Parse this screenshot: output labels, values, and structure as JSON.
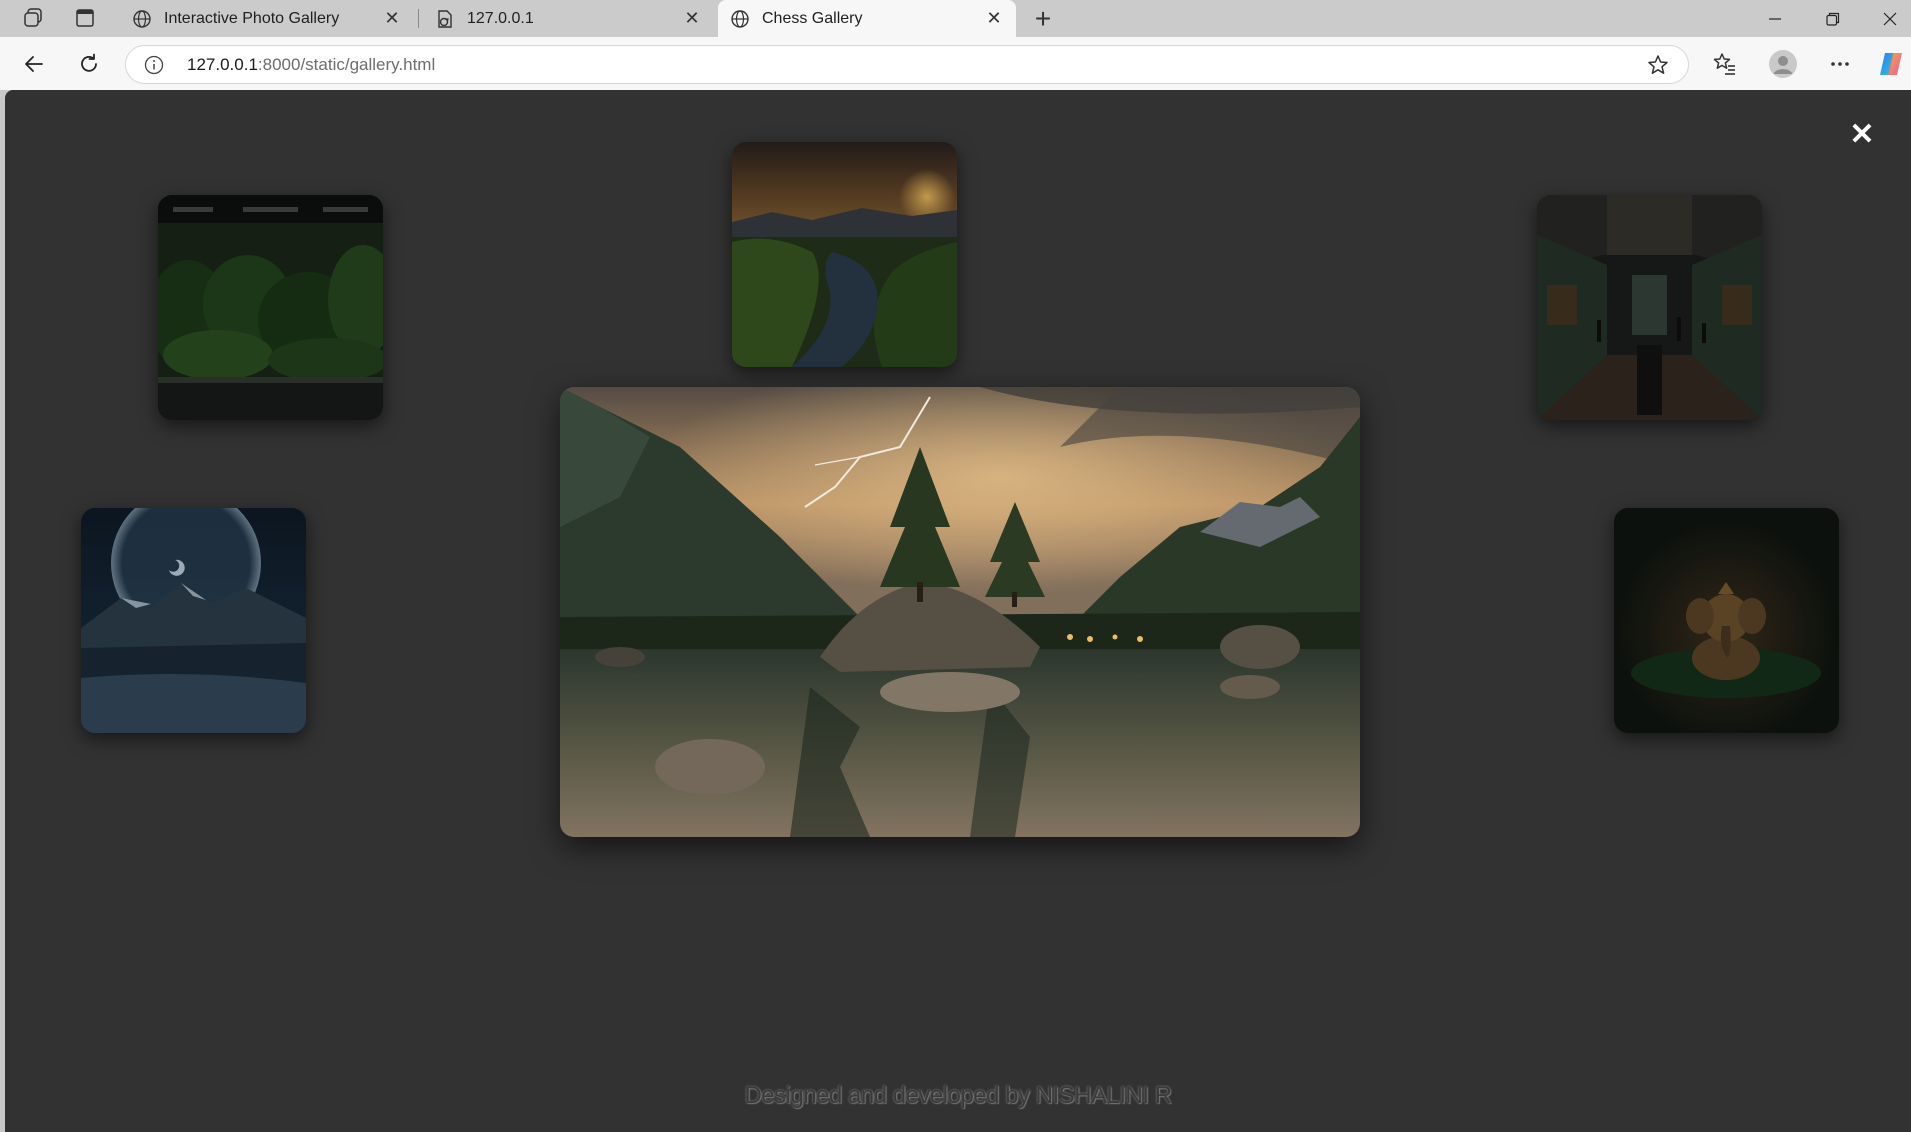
{
  "browser": {
    "tabs": [
      {
        "title": "Interactive Photo Gallery",
        "active": false,
        "icon": "globe-icon"
      },
      {
        "title": "127.0.0.1",
        "active": false,
        "icon": "document-refresh-icon"
      },
      {
        "title": "Chess Gallery",
        "active": true,
        "icon": "globe-icon"
      }
    ],
    "url_host": "127.0.0.1",
    "url_rest": ":8000/static/gallery.html"
  },
  "gallery": {
    "close_symbol": "✕",
    "featured_photo": "lake-with-lightning-and-trees",
    "thumbnails": [
      {
        "subject": "aquarium-plants"
      },
      {
        "subject": "river-sunset"
      },
      {
        "subject": "museum-hall"
      },
      {
        "subject": "moon-over-mountains"
      },
      {
        "subject": "ganesha-statue"
      }
    ]
  },
  "footer": {
    "credit": "Designed and developed by NISHALINI R"
  },
  "colors": {
    "page_background": "#323232",
    "tab_strip": "#cbcbcb",
    "active_tab": "#f7f7f7"
  }
}
